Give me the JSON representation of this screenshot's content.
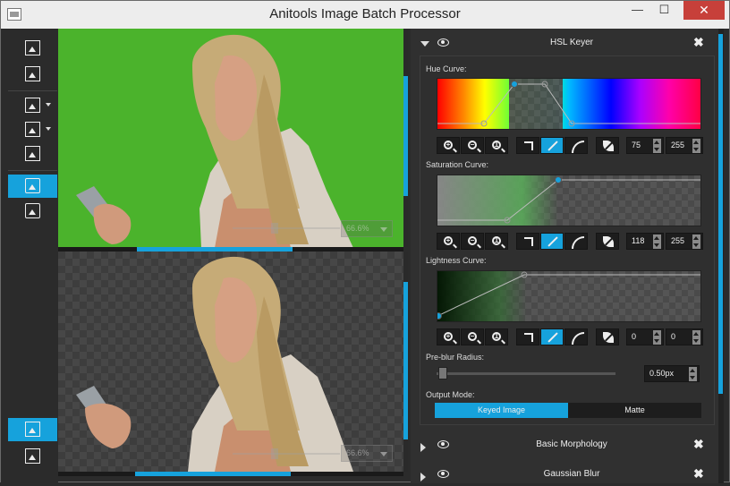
{
  "window": {
    "title": "Anitools Image Batch Processor",
    "minimize_label": "—",
    "maximize_label": "☐",
    "close_label": "✕"
  },
  "toolbar": {
    "items": [
      {
        "name": "open-image",
        "active": false
      },
      {
        "name": "save-image",
        "active": false
      },
      {
        "name": "add-effect",
        "active": false,
        "has_dropdown": true
      },
      {
        "name": "edit-effect",
        "active": false,
        "has_dropdown": true
      },
      {
        "name": "export",
        "active": false
      },
      {
        "name": "view-stacked",
        "active": true
      },
      {
        "name": "view-side-by-side",
        "active": false
      },
      {
        "name": "batch-process",
        "active": true
      },
      {
        "name": "gallery",
        "active": false
      }
    ]
  },
  "viewer": {
    "top_zoom": "66.6%",
    "bottom_zoom": "66.6%"
  },
  "effects": {
    "hsl": {
      "title": "HSL Keyer",
      "hue_label": "Hue Curve:",
      "hue_low": "75",
      "hue_high": "255",
      "saturation_label": "Saturation Curve:",
      "sat_low": "118",
      "sat_high": "255",
      "lightness_label": "Lightness Curve:",
      "light_low": "0",
      "light_high": "0",
      "blur_label": "Pre-blur Radius:",
      "blur_value": "0.50px",
      "output_label": "Output Mode:",
      "output_keyed": "Keyed Image",
      "output_matte": "Matte"
    },
    "morph_title": "Basic Morphology",
    "gauss_title": "Gaussian Blur"
  },
  "colors": {
    "accent": "#16a2dc",
    "green_screen": "#4bb32c",
    "close_red": "#c7403a"
  }
}
